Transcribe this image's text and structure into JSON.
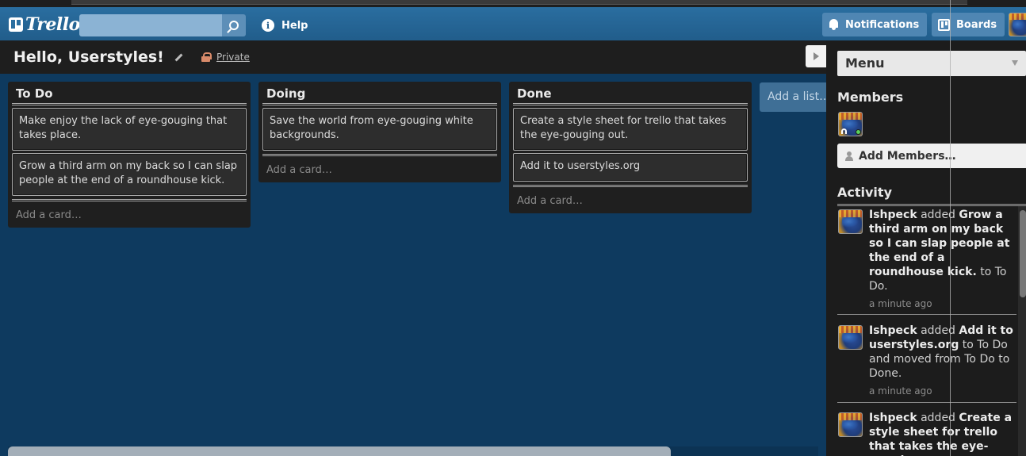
{
  "header": {
    "logo_text": "Trello",
    "search": {
      "placeholder": "",
      "value": ""
    },
    "help_label": "Help",
    "notifications_label": "Notifications",
    "boards_label": "Boards"
  },
  "board": {
    "title": "Hello, Userstyles!",
    "privacy_label": "Private"
  },
  "lists": [
    {
      "title": "To Do",
      "cards": [
        "Make enjoy the lack of eye-gouging that takes place.",
        "Grow a third arm on my back so I can slap people at the end of a roundhouse kick."
      ],
      "add_card_label": "Add a card…"
    },
    {
      "title": "Doing",
      "cards": [
        "Save the world from eye-gouging white backgrounds."
      ],
      "add_card_label": "Add a card…"
    },
    {
      "title": "Done",
      "cards": [
        "Create a style sheet for trello that takes the eye-gouging out.",
        "Add it to userstyles.org"
      ],
      "add_card_label": "Add a card…"
    }
  ],
  "add_list_label": "Add a list…",
  "sidebar": {
    "menu_label": "Menu",
    "members_heading": "Members",
    "add_members_label": "Add Members…",
    "activity_heading": "Activity",
    "activity": [
      {
        "user": "Ishpeck",
        "verb": "added",
        "card": "Grow a third arm on my back so I can slap people at the end of a roundhouse kick.",
        "rest": "to To Do.",
        "time": "a minute ago"
      },
      {
        "user": "Ishpeck",
        "verb": "added",
        "card": "Add it to userstyles.org",
        "rest": "to To Do and moved from To Do to Done.",
        "time": "a minute ago"
      },
      {
        "user": "Ishpeck",
        "verb": "added",
        "card": "Create a style sheet for trello that takes the eye-gouging out.",
        "rest": "",
        "time": ""
      }
    ]
  },
  "colors": {
    "board_bg": "#0e3a5f",
    "header_bg": "#2a6ea0",
    "list_bg": "#1f1f1f",
    "card_bg": "#2d2d2d",
    "sidebar_bg": "#1c1c1c"
  },
  "icons": [
    "trello-logo-icon",
    "search-icon",
    "info-icon",
    "bell-icon",
    "boards-icon",
    "pencil-icon",
    "lock-icon",
    "play-icon",
    "person-icon",
    "caret-down-icon"
  ]
}
